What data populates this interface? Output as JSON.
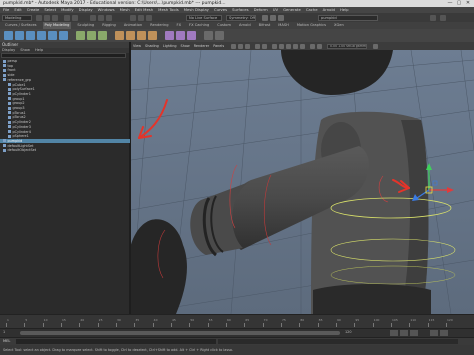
{
  "window": {
    "title": "pumpkid.mb* - Autodesk Maya 2017 - Educational version: C:\\Users\\...\\pumpkid.mb* --- pumpkid...",
    "controls": [
      "—",
      "▢",
      "✕"
    ]
  },
  "menubar": {
    "items": [
      "File",
      "Edit",
      "Create",
      "Select",
      "Modify",
      "Display",
      "Windows",
      "Mesh",
      "Edit Mesh",
      "Mesh Tools",
      "Mesh Display",
      "Curves",
      "Surfaces",
      "Deform",
      "UV",
      "Generate",
      "Cache",
      "Arnold",
      "Help"
    ]
  },
  "statusline": {
    "menuset": "Modeling",
    "symmetry": "Symmetry: Off",
    "no_live": "No Live Surface",
    "search_placeholder": "pumpkid"
  },
  "shelf": {
    "tabs": [
      "Curves / Surfaces",
      "Poly Modeling",
      "Sculpting",
      "Rigging",
      "Animation",
      "Rendering",
      "FX",
      "FX Caching",
      "Custom",
      "Arnold",
      "Bifrost",
      "MASH",
      "Motion Graphics",
      "XGen"
    ],
    "active_tab_index": 1
  },
  "outliner": {
    "title": "Outliner",
    "menu": [
      "Display",
      "Show",
      "Help"
    ],
    "search_placeholder": "",
    "rows": [
      "persp",
      "top",
      "front",
      "side",
      "reference_grp",
      "pCube1",
      "polySurface1",
      "pCylinder1",
      "group1",
      "group2",
      "group3",
      "pTorus1",
      "pTorus2",
      "pCylinder2",
      "pCylinder3",
      "pCylinder4",
      "pSphere1",
      "pumpkid",
      "defaultLightSet",
      "defaultObjectSet"
    ],
    "selected_index": 17
  },
  "viewport": {
    "menu": [
      "View",
      "Shading",
      "Lighting",
      "Show",
      "Renderer",
      "Panels"
    ],
    "camera_field": "0.00   1.00   sRGB gamma"
  },
  "timeline": {
    "ticks": [
      "1",
      "5",
      "10",
      "15",
      "20",
      "25",
      "30",
      "35",
      "40",
      "45",
      "50",
      "55",
      "60",
      "65",
      "70",
      "75",
      "80",
      "85",
      "90",
      "95",
      "100",
      "105",
      "110",
      "115",
      "120"
    ],
    "range_start": "1",
    "range_end": "120"
  },
  "cmdline": {
    "label": "MEL"
  },
  "helpline": {
    "text": "Select Tool: select an object. Drag to marquee select. Shift to toggle, Ctrl to deselect, Ctrl+Shift to add. Alt + Ctrl + Right click to lasso."
  },
  "colors": {
    "viewport_bg": "#65758a",
    "model_gray": "#474747",
    "annotation_red": "#e3342a",
    "selection_blue": "#5285a6",
    "nurbs_yellow": "#d8e06a"
  },
  "icons": [
    "minimize-icon",
    "maximize-icon",
    "close-icon",
    "move-manipulator-icon"
  ]
}
